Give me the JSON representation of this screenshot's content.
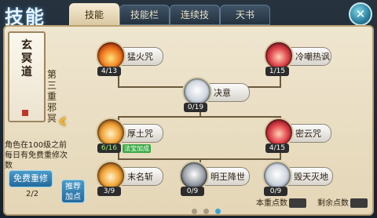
{
  "header": {
    "title": "技能",
    "tabs": [
      {
        "label": "技能",
        "active": true
      },
      {
        "label": "技能栏",
        "active": false
      },
      {
        "label": "连续技",
        "active": false
      },
      {
        "label": "天书",
        "active": false
      }
    ]
  },
  "left": {
    "scroll_text": "玄冥道",
    "vertical_title": "第三重邪冥",
    "description": "角色在100级之前每日有免费重修次数",
    "reset_button": "免费重修",
    "page": "2/2",
    "recommend_button": "推荐加点"
  },
  "skills": [
    {
      "name": "猛火咒",
      "level": "4/13",
      "icon": "fire-skill-icon"
    },
    {
      "name": "冷嘲热讽",
      "level": "1/15",
      "icon": "taunt-skill-icon"
    },
    {
      "name": "决意",
      "level": "0/19",
      "icon": "resolve-skill-icon"
    },
    {
      "name": "厚土咒",
      "level": "6/16",
      "icon": "earth-skill-icon",
      "badge": "法宝加成"
    },
    {
      "name": "密云咒",
      "level": "4/15",
      "icon": "cloud-skill-icon"
    },
    {
      "name": "末名斩",
      "level": "3/9",
      "icon": "slash-skill-icon"
    },
    {
      "name": "明王降世",
      "level": "0/9",
      "icon": "king-skill-icon"
    },
    {
      "name": "毁天灭地",
      "level": "0/9",
      "icon": "destroy-skill-icon"
    }
  ],
  "footer": {
    "pages": 3,
    "current_page": 3,
    "points_label": "本重点数",
    "remaining_label": "剩余点数"
  },
  "colors": {
    "panel": "#efe6d0",
    "accent_blue": "#3aa4d8",
    "badge_green": "#3aa845"
  }
}
